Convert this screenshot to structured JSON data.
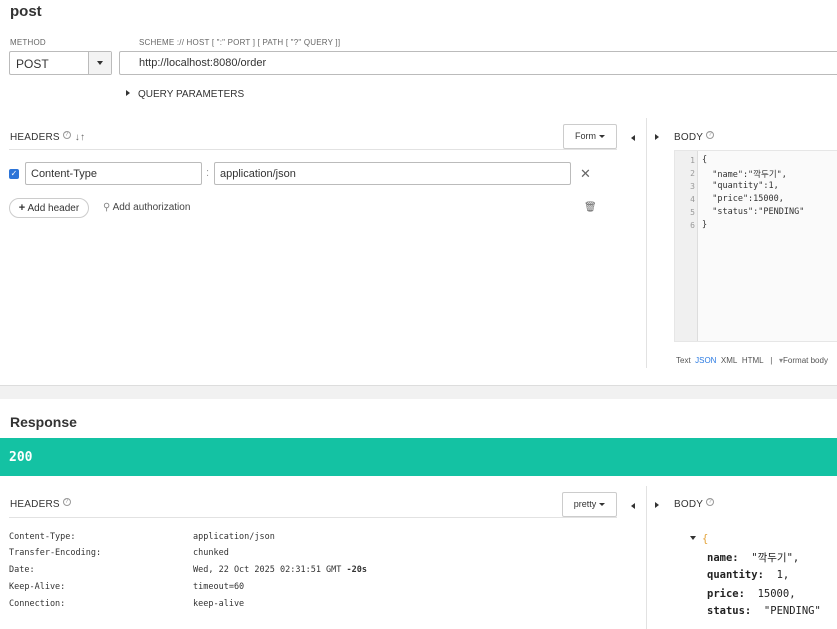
{
  "request": {
    "title": "post",
    "method_label": "METHOD",
    "method": "POST",
    "url_label": "SCHEME :// HOST [ \":\" PORT ] [ PATH [ \"?\" QUERY ]]",
    "url": "http://localhost:8080/order",
    "query_params_label": "QUERY PARAMETERS",
    "headers_label": "HEADERS",
    "form_button": "Form",
    "headers": [
      {
        "enabled": true,
        "name": "Content-Type",
        "value": "application/json"
      }
    ],
    "add_header_label": "Add header",
    "add_auth_label": "Add authorization",
    "body_label": "BODY",
    "body_lines": [
      {
        "n": "1",
        "text": "{"
      },
      {
        "n": "2",
        "text": "  \"name\":\"깍두기\","
      },
      {
        "n": "3",
        "text": "  \"quantity\":1,"
      },
      {
        "n": "4",
        "text": "  \"price\":15000,"
      },
      {
        "n": "5",
        "text": "  \"status\":\"PENDING\""
      },
      {
        "n": "6",
        "text": "}"
      }
    ],
    "format_options": {
      "text": "Text",
      "json": "JSON",
      "xml": "XML",
      "html": "HTML",
      "sep": "|",
      "format_body": "Format body"
    }
  },
  "response": {
    "title": "Response",
    "status_code": "200",
    "status_color": "#14c2a3",
    "headers_label": "HEADERS",
    "pretty_button": "pretty",
    "body_label": "BODY",
    "headers": [
      {
        "name": "Content-Type:",
        "value": "application/json"
      },
      {
        "name": "Transfer-Encoding:",
        "value": "chunked"
      },
      {
        "name": "Date:",
        "value": "Wed, 22 Oct 2025 02:31:51 GMT",
        "extra": "-20s"
      },
      {
        "name": "Keep-Alive:",
        "value": "timeout=60"
      },
      {
        "name": "Connection:",
        "value": "keep-alive"
      }
    ],
    "json_body": {
      "open_brace": "{",
      "rows": [
        {
          "key": "name:",
          "value": "\"깍두기\","
        },
        {
          "key": "quantity:",
          "value": "1,"
        },
        {
          "key": "price:",
          "value": "15000,"
        },
        {
          "key": "status:",
          "value": "\"PENDING\""
        }
      ]
    }
  }
}
